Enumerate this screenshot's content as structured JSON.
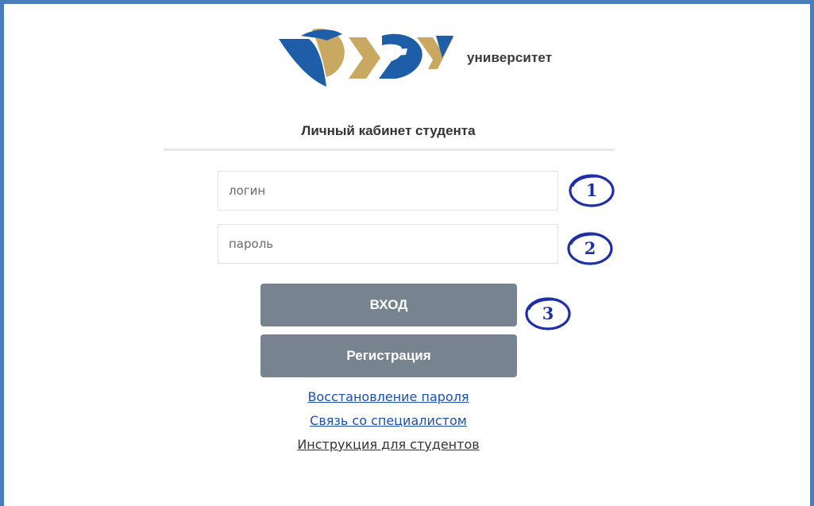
{
  "brand": {
    "logo_text": "ОУЭУ",
    "name": "университет",
    "colors": {
      "blue": "#1e5ea8",
      "gold": "#c9a862"
    }
  },
  "page": {
    "title": "Личный кабинет студента"
  },
  "form": {
    "login_placeholder": "логин",
    "password_placeholder": "пароль",
    "login_button": "ВХОД",
    "register_button": "Регистрация"
  },
  "links": {
    "recover_password": "Восстановление пароля",
    "contact_specialist": "Связь со специалистом",
    "student_instructions": "Инструкция для студентов"
  },
  "annotations": {
    "marker_1": "1",
    "marker_2": "2",
    "marker_3": "3",
    "color": "#1f2fa8"
  },
  "theme": {
    "frame_border": "#4a7ebb",
    "button_bg": "#77848f",
    "link_color": "#1a4fb5"
  }
}
